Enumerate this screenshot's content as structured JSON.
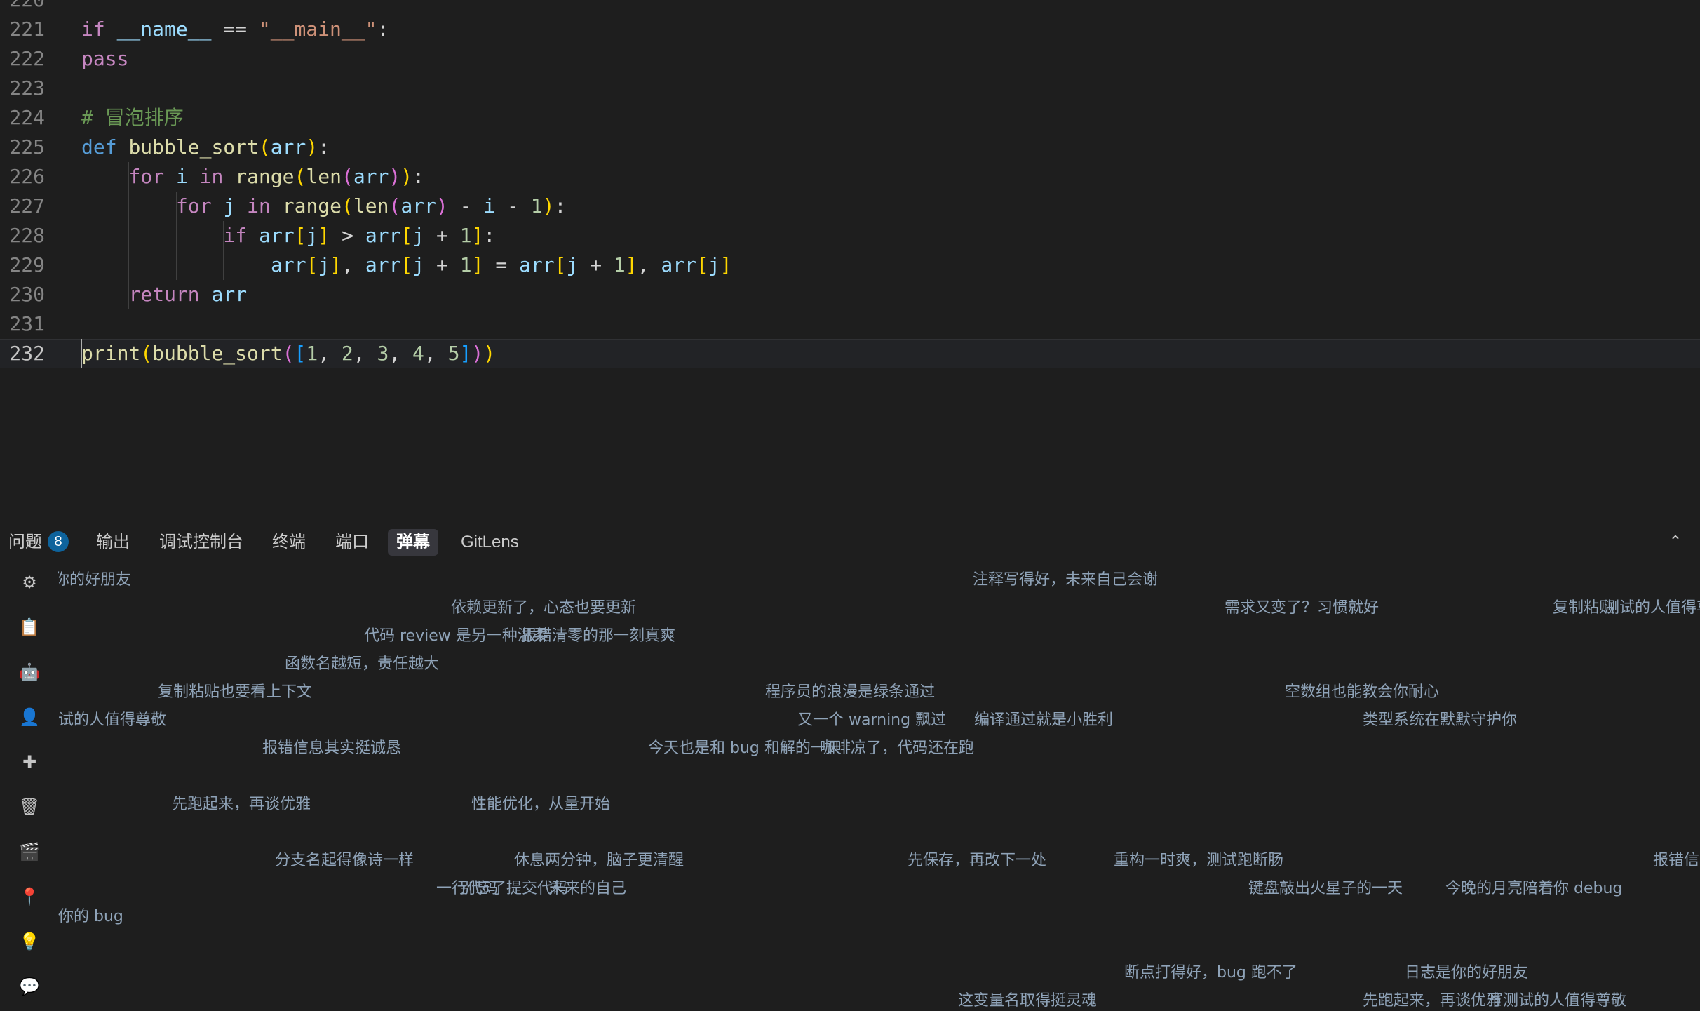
{
  "editor": {
    "lines": [
      {
        "no": "220",
        "tokens": []
      },
      {
        "no": "221",
        "tokens": [
          {
            "t": "if",
            "c": "kw"
          },
          {
            "t": " ",
            "c": "op"
          },
          {
            "t": "__name__",
            "c": "var"
          },
          {
            "t": " == ",
            "c": "op"
          },
          {
            "t": "\"__main__\"",
            "c": "str"
          },
          {
            "t": ":",
            "c": "op"
          }
        ]
      },
      {
        "no": "222",
        "indent": 1,
        "tokens": [
          {
            "t": "pass",
            "c": "kw"
          }
        ]
      },
      {
        "no": "223",
        "indent": 1,
        "tokens": []
      },
      {
        "no": "224",
        "indent": 1,
        "tokens": [
          {
            "t": "# 冒泡排序",
            "c": "cmt"
          }
        ]
      },
      {
        "no": "225",
        "indent": 1,
        "tokens": [
          {
            "t": "def",
            "c": "kw2"
          },
          {
            "t": " ",
            "c": "op"
          },
          {
            "t": "bubble_sort",
            "c": "fn"
          },
          {
            "t": "(",
            "c": "b1"
          },
          {
            "t": "arr",
            "c": "var"
          },
          {
            "t": ")",
            "c": "b1"
          },
          {
            "t": ":",
            "c": "op"
          }
        ]
      },
      {
        "no": "226",
        "indent": 2,
        "tokens": [
          {
            "t": "for",
            "c": "kw"
          },
          {
            "t": " ",
            "c": "op"
          },
          {
            "t": "i",
            "c": "var"
          },
          {
            "t": " ",
            "c": "op"
          },
          {
            "t": "in",
            "c": "kw"
          },
          {
            "t": " ",
            "c": "op"
          },
          {
            "t": "range",
            "c": "fn"
          },
          {
            "t": "(",
            "c": "b1"
          },
          {
            "t": "len",
            "c": "fn"
          },
          {
            "t": "(",
            "c": "b2"
          },
          {
            "t": "arr",
            "c": "var"
          },
          {
            "t": ")",
            "c": "b2"
          },
          {
            "t": ")",
            "c": "b1"
          },
          {
            "t": ":",
            "c": "op"
          }
        ]
      },
      {
        "no": "227",
        "indent": 3,
        "tokens": [
          {
            "t": "for",
            "c": "kw"
          },
          {
            "t": " ",
            "c": "op"
          },
          {
            "t": "j",
            "c": "var"
          },
          {
            "t": " ",
            "c": "op"
          },
          {
            "t": "in",
            "c": "kw"
          },
          {
            "t": " ",
            "c": "op"
          },
          {
            "t": "range",
            "c": "fn"
          },
          {
            "t": "(",
            "c": "b1"
          },
          {
            "t": "len",
            "c": "fn"
          },
          {
            "t": "(",
            "c": "b2"
          },
          {
            "t": "arr",
            "c": "var"
          },
          {
            "t": ")",
            "c": "b2"
          },
          {
            "t": " - ",
            "c": "op"
          },
          {
            "t": "i",
            "c": "var"
          },
          {
            "t": " - ",
            "c": "op"
          },
          {
            "t": "1",
            "c": "num"
          },
          {
            "t": ")",
            "c": "b1"
          },
          {
            "t": ":",
            "c": "op"
          }
        ]
      },
      {
        "no": "228",
        "indent": 4,
        "tokens": [
          {
            "t": "if",
            "c": "kw"
          },
          {
            "t": " ",
            "c": "op"
          },
          {
            "t": "arr",
            "c": "var"
          },
          {
            "t": "[",
            "c": "b1"
          },
          {
            "t": "j",
            "c": "var"
          },
          {
            "t": "]",
            "c": "b1"
          },
          {
            "t": " > ",
            "c": "op"
          },
          {
            "t": "arr",
            "c": "var"
          },
          {
            "t": "[",
            "c": "b1"
          },
          {
            "t": "j",
            "c": "var"
          },
          {
            "t": " + ",
            "c": "op"
          },
          {
            "t": "1",
            "c": "num"
          },
          {
            "t": "]",
            "c": "b1"
          },
          {
            "t": ":",
            "c": "op"
          }
        ]
      },
      {
        "no": "229",
        "indent": 5,
        "tokens": [
          {
            "t": "arr",
            "c": "var"
          },
          {
            "t": "[",
            "c": "b1"
          },
          {
            "t": "j",
            "c": "var"
          },
          {
            "t": "]",
            "c": "b1"
          },
          {
            "t": ", ",
            "c": "op"
          },
          {
            "t": "arr",
            "c": "var"
          },
          {
            "t": "[",
            "c": "b1"
          },
          {
            "t": "j",
            "c": "var"
          },
          {
            "t": " + ",
            "c": "op"
          },
          {
            "t": "1",
            "c": "num"
          },
          {
            "t": "]",
            "c": "b1"
          },
          {
            "t": " = ",
            "c": "op"
          },
          {
            "t": "arr",
            "c": "var"
          },
          {
            "t": "[",
            "c": "b1"
          },
          {
            "t": "j",
            "c": "var"
          },
          {
            "t": " + ",
            "c": "op"
          },
          {
            "t": "1",
            "c": "num"
          },
          {
            "t": "]",
            "c": "b1"
          },
          {
            "t": ", ",
            "c": "op"
          },
          {
            "t": "arr",
            "c": "var"
          },
          {
            "t": "[",
            "c": "b1"
          },
          {
            "t": "j",
            "c": "var"
          },
          {
            "t": "]",
            "c": "b1"
          }
        ]
      },
      {
        "no": "230",
        "indent": 2,
        "tokens": [
          {
            "t": "return",
            "c": "kw"
          },
          {
            "t": " ",
            "c": "op"
          },
          {
            "t": "arr",
            "c": "var"
          }
        ]
      },
      {
        "no": "231",
        "indent": 1,
        "tokens": []
      },
      {
        "no": "232",
        "indent": 1,
        "current": true,
        "tokens": [
          {
            "t": "print",
            "c": "fn"
          },
          {
            "t": "(",
            "c": "b1"
          },
          {
            "t": "bubble_sort",
            "c": "fn"
          },
          {
            "t": "(",
            "c": "b2"
          },
          {
            "t": "[",
            "c": "b3"
          },
          {
            "t": "1",
            "c": "num"
          },
          {
            "t": ", ",
            "c": "op"
          },
          {
            "t": "2",
            "c": "num"
          },
          {
            "t": ", ",
            "c": "op"
          },
          {
            "t": "3",
            "c": "num"
          },
          {
            "t": ", ",
            "c": "op"
          },
          {
            "t": "4",
            "c": "num"
          },
          {
            "t": ", ",
            "c": "op"
          },
          {
            "t": "5",
            "c": "num"
          },
          {
            "t": "]",
            "c": "b3"
          },
          {
            "t": ")",
            "c": "b2"
          },
          {
            "t": ")",
            "c": "b1"
          }
        ]
      }
    ]
  },
  "panel": {
    "tabs": [
      {
        "id": "problems",
        "label": "问题",
        "badge": "8"
      },
      {
        "id": "output",
        "label": "输出"
      },
      {
        "id": "debug-console",
        "label": "调试控制台"
      },
      {
        "id": "terminal",
        "label": "终端"
      },
      {
        "id": "ports",
        "label": "端口"
      },
      {
        "id": "danmaku",
        "label": "弹幕",
        "active": true
      },
      {
        "id": "gitlens",
        "label": "GitLens"
      }
    ],
    "side_icons": [
      {
        "name": "gear-icon",
        "glyph": "⚙"
      },
      {
        "name": "clipboard-icon",
        "glyph": "📋"
      },
      {
        "name": "robot-icon",
        "glyph": "🤖"
      },
      {
        "name": "user-icon",
        "glyph": "👤"
      },
      {
        "name": "plus-icon",
        "glyph": "✚"
      },
      {
        "name": "trash-icon",
        "glyph": "🗑"
      },
      {
        "name": "clapper-icon",
        "glyph": "🎬"
      },
      {
        "name": "pin-icon",
        "glyph": "📍"
      },
      {
        "name": "lightbulb-icon",
        "glyph": "💡"
      },
      {
        "name": "chat-icon",
        "glyph": "💬"
      }
    ],
    "chevron": "⌃",
    "danmaku": [
      "你的好朋友",
      "注释写得好，未来自己会谢",
      "依赖更新了，心态也要更新",
      "需求又变了？习惯就好",
      "复制粘贴",
      "测试的人值得尊敬",
      "代码 review 是另一种温柔",
      "报错清零的那一刻真爽",
      "函数名越短，责任越大",
      "复制粘贴也要看上下文",
      "程序员的浪漫是绿条通过",
      "空数组也能教会你耐心",
      "试的人值得尊敬",
      "又一个 warning 飘过",
      "编译通过就是小胜利",
      "类型系统在默默守护你",
      "报错信息其实挺诚恳",
      "今天也是和 bug 和解的一天",
      "咖啡凉了，代码还在跑",
      "先跑起来，再谈优雅",
      "性能优化，从量开始",
      "分支名起得像诗一样",
      "休息两分钟，脑子更清醒",
      "先保存，再改下一处",
      "重构一时爽，测试跑断肠",
      "报错信",
      "一行代码",
      "别忘了提交代码",
      "未来的自己",
      "键盘敲出火星子的一天",
      "今晚的月亮陪着你 debug",
      "你的 bug",
      "断点打得好，bug 跑不了",
      "日志是你的好朋友",
      "这变量名取得挺灵魂",
      "先跑起来，再谈优雅",
      "写测试的人值得尊敬"
    ]
  }
}
